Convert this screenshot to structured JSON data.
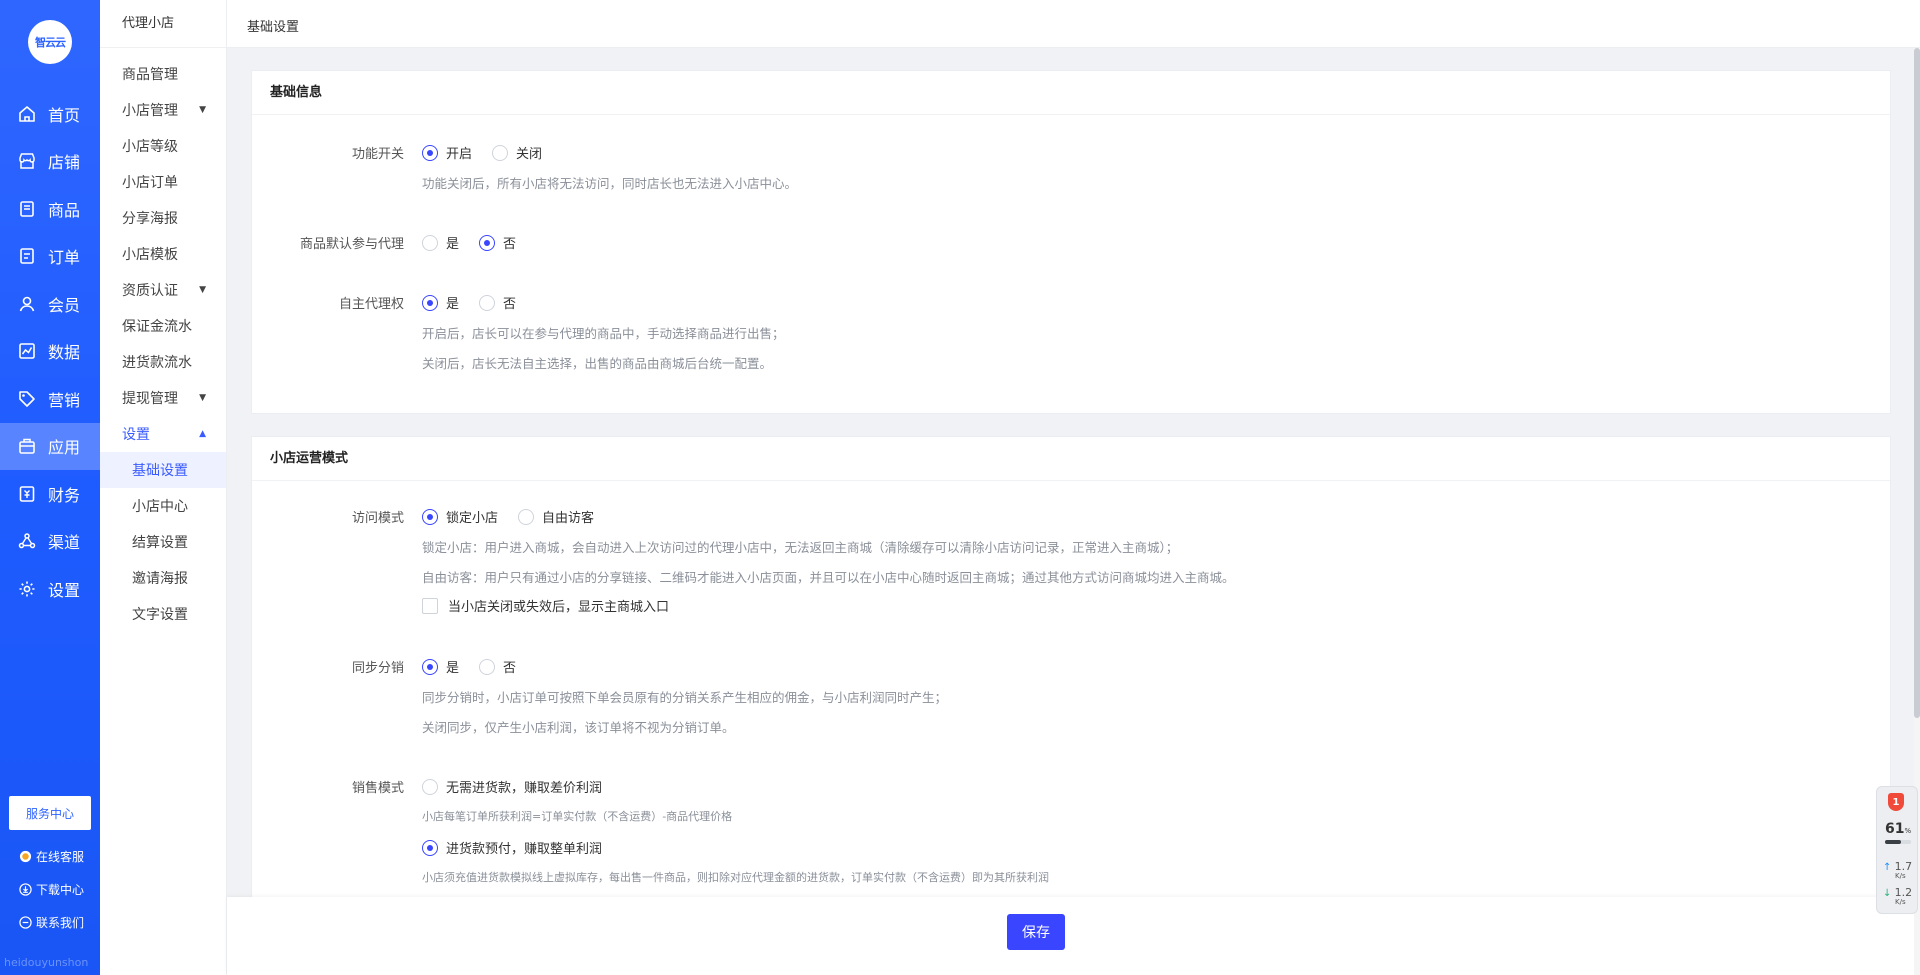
{
  "app": {
    "logo_text": "智云云",
    "watermark": "heidouyunshon"
  },
  "nav": {
    "items": [
      {
        "label": "首页",
        "icon": "home-icon"
      },
      {
        "label": "店铺",
        "icon": "store-icon"
      },
      {
        "label": "商品",
        "icon": "goods-icon"
      },
      {
        "label": "订单",
        "icon": "order-icon"
      },
      {
        "label": "会员",
        "icon": "member-icon"
      },
      {
        "label": "数据",
        "icon": "chart-icon"
      },
      {
        "label": "营销",
        "icon": "tag-icon"
      },
      {
        "label": "应用",
        "icon": "app-icon",
        "active": true
      },
      {
        "label": "财务",
        "icon": "finance-icon"
      },
      {
        "label": "渠道",
        "icon": "channel-icon"
      },
      {
        "label": "设置",
        "icon": "gear-icon"
      }
    ],
    "service_center": "服务中心",
    "online_service": "在线客服",
    "download_center": "下载中心",
    "contact_us": "联系我们"
  },
  "subnav": {
    "title": "代理小店",
    "items": [
      {
        "label": "商品管理"
      },
      {
        "label": "小店管理",
        "caret": "▼"
      },
      {
        "label": "小店等级"
      },
      {
        "label": "小店订单"
      },
      {
        "label": "分享海报"
      },
      {
        "label": "小店模板"
      },
      {
        "label": "资质认证",
        "caret": "▼"
      },
      {
        "label": "保证金流水"
      },
      {
        "label": "进货款流水"
      },
      {
        "label": "提现管理",
        "caret": "▼"
      },
      {
        "label": "设置",
        "caret": "▲"
      }
    ],
    "sub_items": [
      {
        "label": "基础设置",
        "active": true
      },
      {
        "label": "小店中心"
      },
      {
        "label": "结算设置"
      },
      {
        "label": "邀请海报"
      },
      {
        "label": "文字设置"
      }
    ]
  },
  "header": {
    "breadcrumb": "基础设置"
  },
  "basic": {
    "title": "基础信息",
    "switch": {
      "label": "功能开关",
      "options": [
        "开启",
        "关闭"
      ],
      "selected": "开启",
      "hint": "功能关闭后，所有小店将无法访问，同时店长也无法进入小店中心。"
    },
    "default_agent": {
      "label": "商品默认参与代理",
      "options": [
        "是",
        "否"
      ],
      "selected": "否"
    },
    "self_agent": {
      "label": "自主代理权",
      "options": [
        "是",
        "否"
      ],
      "selected": "是",
      "hint1": "开启后，店长可以在参与代理的商品中，手动选择商品进行出售；",
      "hint2": "关闭后，店长无法自主选择，出售的商品由商城后台统一配置。"
    }
  },
  "mode": {
    "title": "小店运营模式",
    "access": {
      "label": "访问模式",
      "options": [
        "锁定小店",
        "自由访客"
      ],
      "selected": "锁定小店",
      "hint1": "锁定小店：用户进入商城，会自动进入上次访问过的代理小店中，无法返回主商城（清除缓存可以清除小店访问记录，正常进入主商城）；",
      "hint2": "自由访客：用户只有通过小店的分享链接、二维码才能进入小店页面，并且可以在小店中心随时返回主商城；通过其他方式访问商城均进入主商城。",
      "checkbox": "当小店关闭或失效后，显示主商城入口"
    },
    "sync": {
      "label": "同步分销",
      "options": [
        "是",
        "否"
      ],
      "selected": "是",
      "hint1": "同步分销时，小店订单可按照下单会员原有的分销关系产生相应的佣金，与小店利润同时产生；",
      "hint2": "关闭同步，仅产生小店利润，该订单将不视为分销订单。"
    },
    "sales": {
      "label": "销售模式",
      "option1": "无需进货款，赚取差价利润",
      "hint1": "小店每笔订单所获利润=订单实付款（不含运费）-商品代理价格",
      "option2": "进货款预付，赚取整单利润",
      "hint2": "小店须充值进货款模拟线上虚拟库存，每出售一件商品，则扣除对应代理金额的进货款，订单实付款（不含运费）即为其所获利润",
      "selected": "option2"
    }
  },
  "footer": {
    "save_label": "保存"
  },
  "widget": {
    "badge": "1",
    "percent": "61",
    "percent_unit": "%",
    "percent_value": 0.61,
    "up_speed": "1.7",
    "up_unit": "K/s",
    "down_speed": "1.2",
    "down_unit": "K/s"
  }
}
